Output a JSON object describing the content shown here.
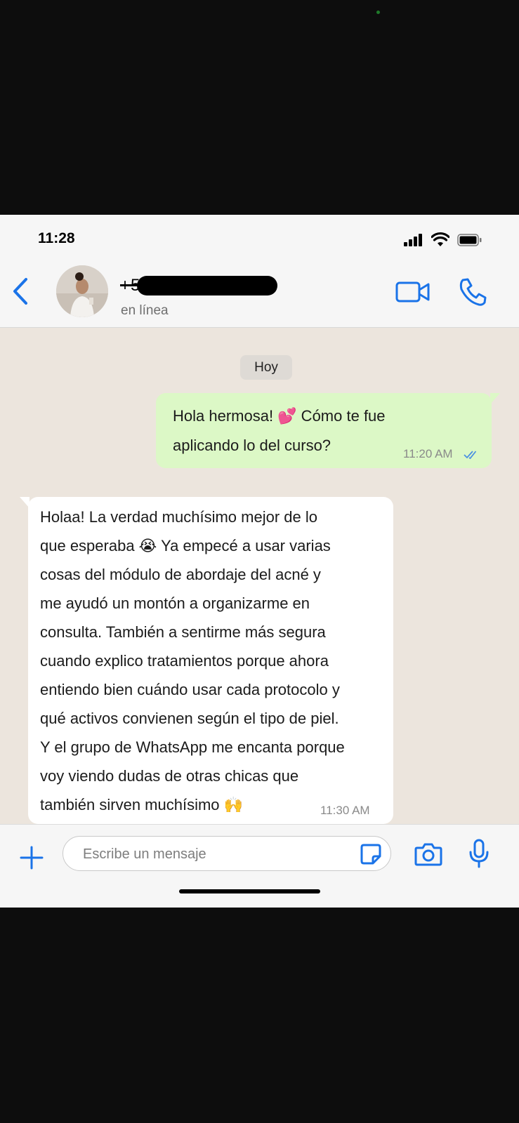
{
  "status_bar": {
    "time": "11:28"
  },
  "header": {
    "contact_number": "+55 1",
    "contact_status": "en línea",
    "icons": [
      "back-chevron-icon",
      "video-camera-icon",
      "phone-icon"
    ]
  },
  "chat": {
    "date_chip": "Hoy",
    "messages": [
      {
        "direction": "outgoing",
        "lines": [
          "Hola hermosa! 💕 Cómo te fue",
          "aplicando lo del curso?"
        ],
        "time": "11:20 AM",
        "status": "read"
      },
      {
        "direction": "incoming",
        "lines": [
          "Holaa! La verdad muchísimo mejor de lo",
          "que esperaba 😭 Ya empecé a usar varias",
          "cosas del módulo de abordaje del acné y",
          "me ayudó un montón a organizarme en",
          "consulta. También a sentirme más segura",
          "cuando explico tratamientos porque ahora",
          "entiendo bien cuándo usar cada protocolo y",
          "qué activos convienen según el tipo de piel.",
          "Y el grupo de WhatsApp me encanta porque",
          "voy viendo dudas de otras chicas que",
          "también sirven muchísimo 🙌"
        ],
        "time": "11:30 AM"
      }
    ]
  },
  "input_bar": {
    "placeholder": "Escribe un mensaje",
    "icons": [
      "plus-icon",
      "sticker-icon",
      "camera-icon",
      "microphone-icon"
    ]
  },
  "colors": {
    "accent_blue": "#1a73e8",
    "outgoing_bubble": "#dcf8c6",
    "incoming_bubble": "#ffffff",
    "chat_background": "#ece5dd"
  }
}
